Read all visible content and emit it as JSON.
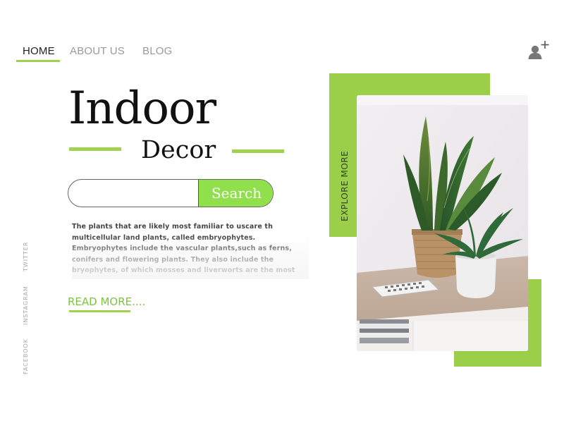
{
  "nav": {
    "home": "HOME",
    "about": "ABOUT US",
    "blog": "BLOG"
  },
  "header": {
    "add_user_icon": "user-plus-icon"
  },
  "hero": {
    "title": "Indoor",
    "subtitle": "Decor"
  },
  "search": {
    "placeholder": "",
    "value": "",
    "button_label": "Search"
  },
  "description": "The plants that are likely most familiar to uscare th multicellular land plants, called embryophytes. Embryophytes include the vascular plants,such as ferns, conifers and flowering plants. They also include the bryophytes, of which mosses and liverworts are the most common.",
  "read_more": "READ MORE....",
  "social": {
    "twitter": "TWITTER",
    "instagram": "INSTAGRAM",
    "facebook": "FACEBOOK"
  },
  "explore": "EXPLORE MORE",
  "colors": {
    "accent": "#9ccf49",
    "button": "#8fe04a",
    "link": "#7cc43e"
  }
}
